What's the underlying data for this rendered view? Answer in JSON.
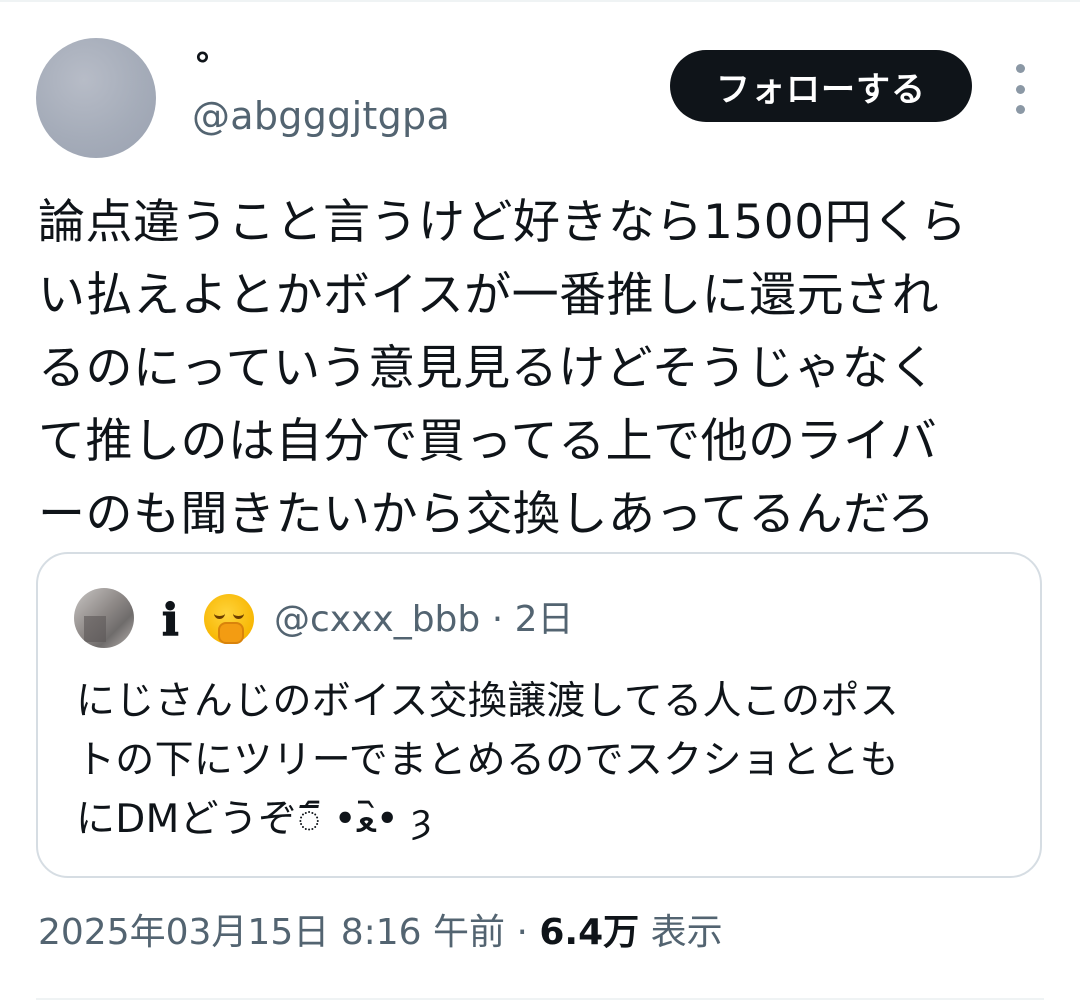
{
  "post": {
    "author": {
      "display_name": "°",
      "handle": "@abgggjtgpa"
    },
    "follow_label": "フォローする",
    "more_icon": "more-vertical-icon",
    "text": "論点違うこと言うけど好きなら1500円くら\nい払えよとかボイスが一番推しに還元され\nるのにっていう意見見るけどそうじゃなく\nて推しのは自分で買ってる上で他のライバ\nーのも聞きたいから交換しあってるんだろ",
    "quote": {
      "info_icon": "ℹ",
      "emoji": "yawning-face",
      "handle": "@cxxx_bbb",
      "separator": "·",
      "time": "2日",
      "text": "にじさんじのボイス交換譲渡してる人このポス\nトの下にツリーでまとめるのでスクショととも\nにDMどうぞ𐨸 ᷇•ﻌ•᷆ ȝ"
    },
    "meta": {
      "date": "2025年03月15日",
      "time": "8:16 午前",
      "separator": "·",
      "views_count": "6.4万",
      "views_label": "表示"
    }
  },
  "colors": {
    "text_primary": "#0f1419",
    "text_secondary": "#536471",
    "follow_button_bg": "#0f1419",
    "border": "#d6dde3"
  }
}
